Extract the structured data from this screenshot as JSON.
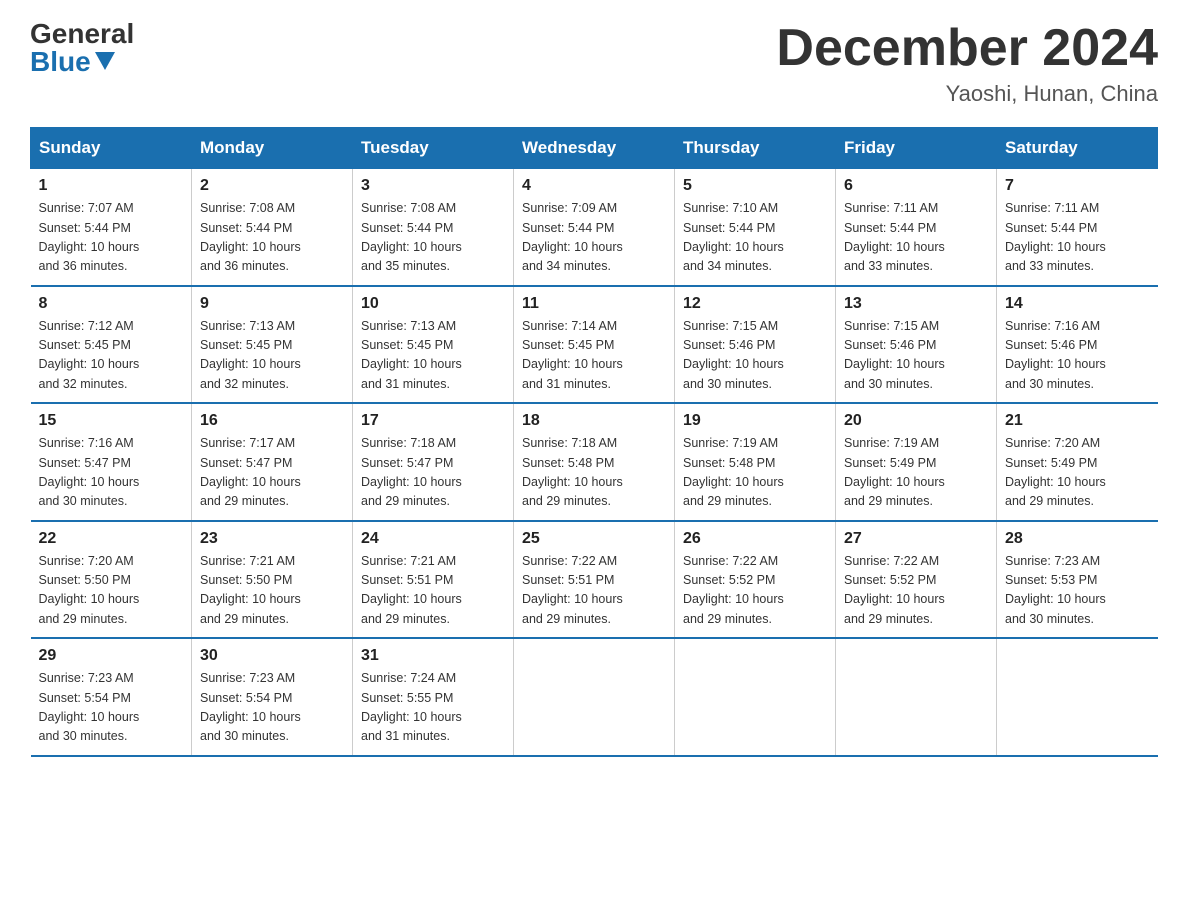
{
  "logo": {
    "general": "General",
    "blue": "Blue"
  },
  "title": "December 2024",
  "location": "Yaoshi, Hunan, China",
  "days_of_week": [
    "Sunday",
    "Monday",
    "Tuesday",
    "Wednesday",
    "Thursday",
    "Friday",
    "Saturday"
  ],
  "weeks": [
    [
      {
        "day": "1",
        "sunrise": "7:07 AM",
        "sunset": "5:44 PM",
        "daylight": "10 hours and 36 minutes."
      },
      {
        "day": "2",
        "sunrise": "7:08 AM",
        "sunset": "5:44 PM",
        "daylight": "10 hours and 36 minutes."
      },
      {
        "day": "3",
        "sunrise": "7:08 AM",
        "sunset": "5:44 PM",
        "daylight": "10 hours and 35 minutes."
      },
      {
        "day": "4",
        "sunrise": "7:09 AM",
        "sunset": "5:44 PM",
        "daylight": "10 hours and 34 minutes."
      },
      {
        "day": "5",
        "sunrise": "7:10 AM",
        "sunset": "5:44 PM",
        "daylight": "10 hours and 34 minutes."
      },
      {
        "day": "6",
        "sunrise": "7:11 AM",
        "sunset": "5:44 PM",
        "daylight": "10 hours and 33 minutes."
      },
      {
        "day": "7",
        "sunrise": "7:11 AM",
        "sunset": "5:44 PM",
        "daylight": "10 hours and 33 minutes."
      }
    ],
    [
      {
        "day": "8",
        "sunrise": "7:12 AM",
        "sunset": "5:45 PM",
        "daylight": "10 hours and 32 minutes."
      },
      {
        "day": "9",
        "sunrise": "7:13 AM",
        "sunset": "5:45 PM",
        "daylight": "10 hours and 32 minutes."
      },
      {
        "day": "10",
        "sunrise": "7:13 AM",
        "sunset": "5:45 PM",
        "daylight": "10 hours and 31 minutes."
      },
      {
        "day": "11",
        "sunrise": "7:14 AM",
        "sunset": "5:45 PM",
        "daylight": "10 hours and 31 minutes."
      },
      {
        "day": "12",
        "sunrise": "7:15 AM",
        "sunset": "5:46 PM",
        "daylight": "10 hours and 30 minutes."
      },
      {
        "day": "13",
        "sunrise": "7:15 AM",
        "sunset": "5:46 PM",
        "daylight": "10 hours and 30 minutes."
      },
      {
        "day": "14",
        "sunrise": "7:16 AM",
        "sunset": "5:46 PM",
        "daylight": "10 hours and 30 minutes."
      }
    ],
    [
      {
        "day": "15",
        "sunrise": "7:16 AM",
        "sunset": "5:47 PM",
        "daylight": "10 hours and 30 minutes."
      },
      {
        "day": "16",
        "sunrise": "7:17 AM",
        "sunset": "5:47 PM",
        "daylight": "10 hours and 29 minutes."
      },
      {
        "day": "17",
        "sunrise": "7:18 AM",
        "sunset": "5:47 PM",
        "daylight": "10 hours and 29 minutes."
      },
      {
        "day": "18",
        "sunrise": "7:18 AM",
        "sunset": "5:48 PM",
        "daylight": "10 hours and 29 minutes."
      },
      {
        "day": "19",
        "sunrise": "7:19 AM",
        "sunset": "5:48 PM",
        "daylight": "10 hours and 29 minutes."
      },
      {
        "day": "20",
        "sunrise": "7:19 AM",
        "sunset": "5:49 PM",
        "daylight": "10 hours and 29 minutes."
      },
      {
        "day": "21",
        "sunrise": "7:20 AM",
        "sunset": "5:49 PM",
        "daylight": "10 hours and 29 minutes."
      }
    ],
    [
      {
        "day": "22",
        "sunrise": "7:20 AM",
        "sunset": "5:50 PM",
        "daylight": "10 hours and 29 minutes."
      },
      {
        "day": "23",
        "sunrise": "7:21 AM",
        "sunset": "5:50 PM",
        "daylight": "10 hours and 29 minutes."
      },
      {
        "day": "24",
        "sunrise": "7:21 AM",
        "sunset": "5:51 PM",
        "daylight": "10 hours and 29 minutes."
      },
      {
        "day": "25",
        "sunrise": "7:22 AM",
        "sunset": "5:51 PM",
        "daylight": "10 hours and 29 minutes."
      },
      {
        "day": "26",
        "sunrise": "7:22 AM",
        "sunset": "5:52 PM",
        "daylight": "10 hours and 29 minutes."
      },
      {
        "day": "27",
        "sunrise": "7:22 AM",
        "sunset": "5:52 PM",
        "daylight": "10 hours and 29 minutes."
      },
      {
        "day": "28",
        "sunrise": "7:23 AM",
        "sunset": "5:53 PM",
        "daylight": "10 hours and 30 minutes."
      }
    ],
    [
      {
        "day": "29",
        "sunrise": "7:23 AM",
        "sunset": "5:54 PM",
        "daylight": "10 hours and 30 minutes."
      },
      {
        "day": "30",
        "sunrise": "7:23 AM",
        "sunset": "5:54 PM",
        "daylight": "10 hours and 30 minutes."
      },
      {
        "day": "31",
        "sunrise": "7:24 AM",
        "sunset": "5:55 PM",
        "daylight": "10 hours and 31 minutes."
      },
      null,
      null,
      null,
      null
    ]
  ],
  "labels": {
    "sunrise": "Sunrise:",
    "sunset": "Sunset:",
    "daylight": "Daylight:"
  }
}
